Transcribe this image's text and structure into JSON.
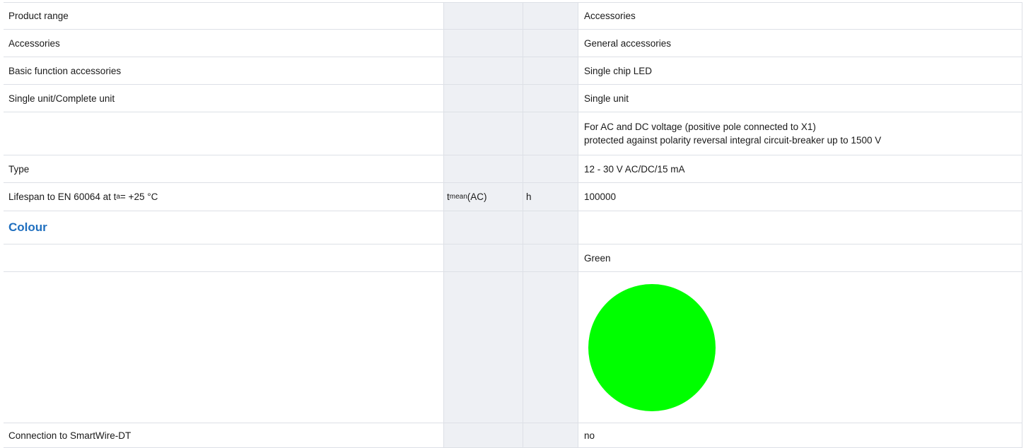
{
  "rows": [
    {
      "label": "Product range",
      "value": "Accessories"
    },
    {
      "label": "Accessories",
      "value": "General accessories"
    },
    {
      "label": "Basic function accessories",
      "value": "Single chip LED"
    },
    {
      "label": "Single unit/Complete unit",
      "value": "Single unit"
    },
    {
      "label": "",
      "value_lines": [
        "For AC and DC voltage (positive pole connected to X1)",
        "protected against polarity reversal integral circuit-breaker up to 1500 V"
      ]
    },
    {
      "label": "Type",
      "value": "12 - 30 V AC/DC/15 mA"
    }
  ],
  "lifespan": {
    "label_prefix": "Lifespan to EN 60064 at t",
    "label_sub": "a",
    "label_suffix": " = +25 °C",
    "symbol": "t",
    "symbol_sub": "mean",
    "symbol_suffix": " (AC)",
    "unit": "h",
    "value": "100000"
  },
  "colour_heading": "Colour",
  "colour_value": "Green",
  "swatch_color": "#00ff00",
  "smartwire": {
    "label": "Connection to SmartWire-DT",
    "value": "no"
  }
}
